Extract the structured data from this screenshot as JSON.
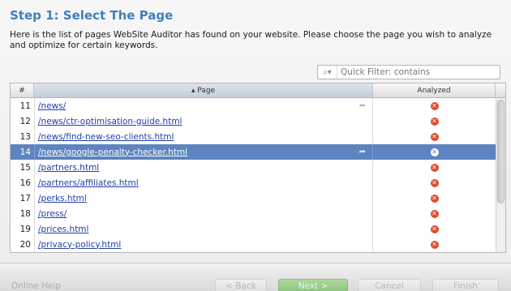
{
  "header": {
    "title": "Step 1: Select The Page",
    "description": "Here is the list of pages WebSite Auditor has found on your website. Please choose the page you wish to analyze and optimize for certain keywords."
  },
  "filter": {
    "placeholder": "Quick Filter: contains",
    "value": "",
    "icon": "search-icon"
  },
  "table": {
    "columns": [
      "#",
      "▴ Page",
      "Analyzed"
    ],
    "rows": [
      {
        "num": "11",
        "page": "/news/",
        "analyzed": "not-analyzed",
        "selected": false
      },
      {
        "num": "12",
        "page": "/news/ctr-optimisation-guide.html",
        "analyzed": "not-analyzed",
        "selected": false
      },
      {
        "num": "13",
        "page": "/news/find-new-seo-clients.html",
        "analyzed": "not-analyzed",
        "selected": false
      },
      {
        "num": "14",
        "page": "/news/google-penalty-checker.html",
        "analyzed": "not-analyzed",
        "selected": true
      },
      {
        "num": "15",
        "page": "/partners.html",
        "analyzed": "not-analyzed",
        "selected": false
      },
      {
        "num": "16",
        "page": "/partners/affiliates.html",
        "analyzed": "not-analyzed",
        "selected": false
      },
      {
        "num": "17",
        "page": "/perks.html",
        "analyzed": "not-analyzed",
        "selected": false
      },
      {
        "num": "18",
        "page": "/press/",
        "analyzed": "not-analyzed",
        "selected": false
      },
      {
        "num": "19",
        "page": "/prices.html",
        "analyzed": "not-analyzed",
        "selected": false
      },
      {
        "num": "20",
        "page": "/privacy-policy.html",
        "analyzed": "not-analyzed",
        "selected": false
      }
    ]
  },
  "footer": {
    "help": "Online Help",
    "back": "< Back",
    "next": "Next >",
    "cancel": "Cancel",
    "finish": "Finish"
  },
  "colors": {
    "title": "#3f7fc0",
    "selection": "#5c84c0",
    "error_icon": "#e04b2a",
    "link": "#1f3fa8"
  }
}
